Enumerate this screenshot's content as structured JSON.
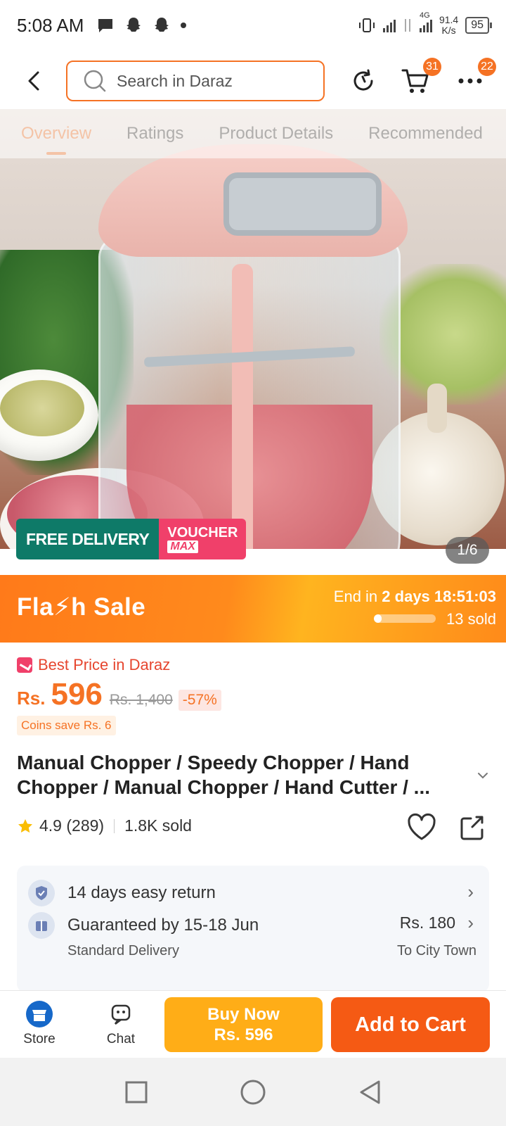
{
  "status_bar": {
    "time": "5:08 AM",
    "network_speed_value": "91.4",
    "network_speed_unit": "K/s",
    "network_type": "4G",
    "battery": "95"
  },
  "top_nav": {
    "search_placeholder": "Search in Daraz",
    "cart_badge": "31",
    "more_badge": "22"
  },
  "hero": {
    "tabs": [
      "Overview",
      "Ratings",
      "Product Details",
      "Recommended"
    ],
    "active_tab": 0,
    "promo_free": "FREE DELIVERY",
    "promo_voucher": "VOUCHER",
    "promo_voucher_sub": "MAX",
    "image_counter": "1/6"
  },
  "flash_sale": {
    "title": "Fla⚡h  Sale",
    "end_prefix": "End in",
    "end_days": "2 days",
    "end_time": "18:51:03",
    "sold": "13 sold",
    "progress": 0.12
  },
  "price": {
    "best_price_label": "Best Price in Daraz",
    "currency": "Rs.",
    "current": "596",
    "original": "Rs. 1,400",
    "discount": "-57%",
    "coins": "Coins save Rs. 6"
  },
  "product": {
    "title": "Manual Chopper / Speedy Chopper / Hand Chopper / Manual Chopper / Hand Cutter / ...",
    "rating": "4.9",
    "reviews": "(289)",
    "sold": "1.8K sold"
  },
  "services": {
    "return_label": "14 days easy return",
    "delivery_label": "Guaranteed by 15-18 Jun",
    "delivery_type": "Standard Delivery",
    "delivery_price": "Rs. 180",
    "delivery_location": "To City Town"
  },
  "action_bar": {
    "store_label": "Store",
    "chat_label": "Chat",
    "buy_now_label": "Buy Now",
    "buy_now_price": "Rs. 596",
    "add_to_cart_label": "Add to Cart"
  },
  "colors": {
    "accent": "#f57224",
    "flash_orange": "#ff7a1a",
    "buy_now": "#ffad17",
    "add_to_cart": "#f55a14",
    "free_delivery": "#0e7a68",
    "voucher": "#f0406a"
  }
}
